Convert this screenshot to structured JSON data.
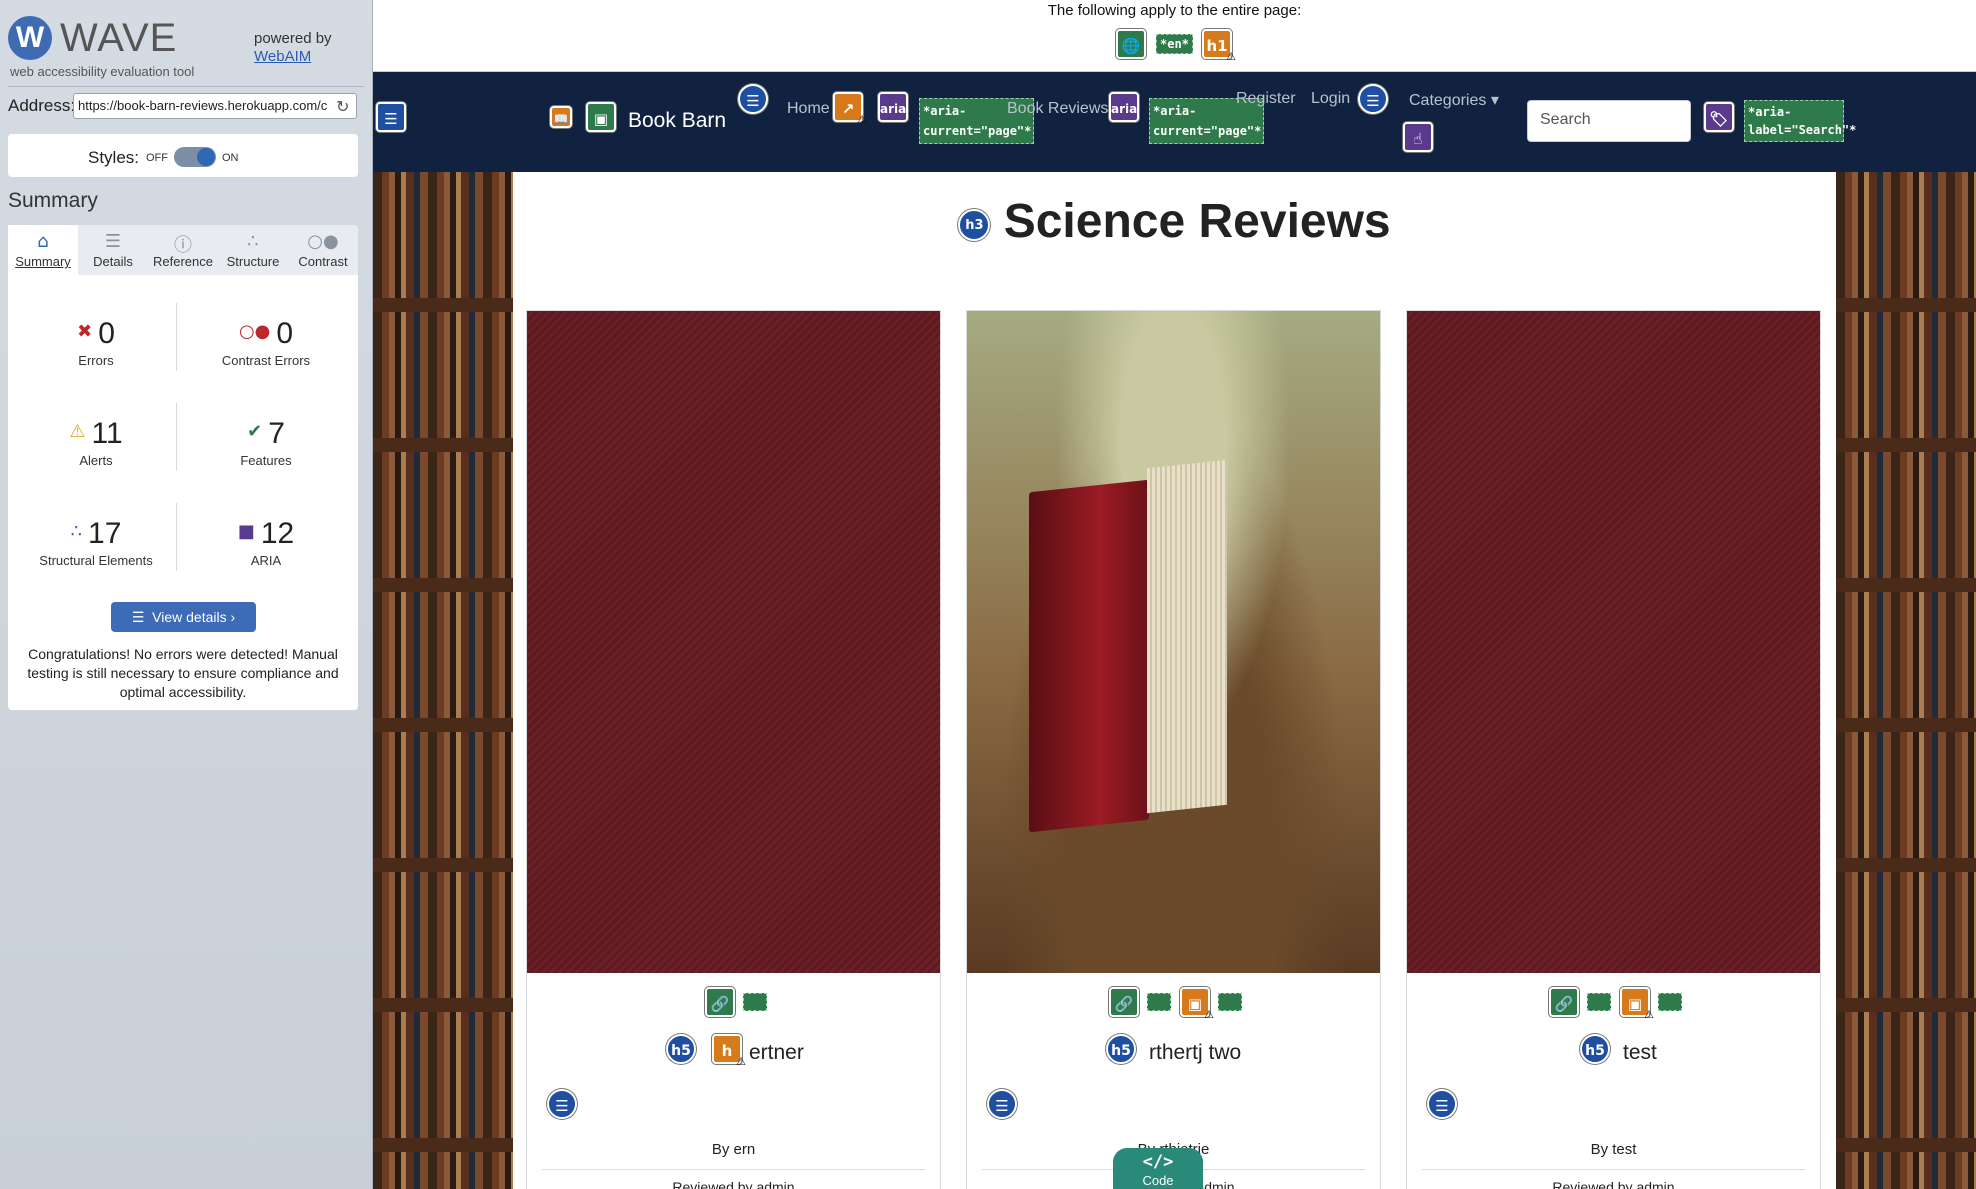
{
  "wave": {
    "title": "WAVE",
    "tagline": "web accessibility evaluation tool",
    "powered_by": "powered by",
    "webaim": "WebAIM",
    "address_label": "Address:",
    "address_value": "https://book-barn-reviews.herokuapp.com/c",
    "styles_label": "Styles:",
    "styles_off": "OFF",
    "styles_on": "ON",
    "summary_title": "Summary",
    "tabs": [
      {
        "label": "Summary",
        "icon": "home-icon"
      },
      {
        "label": "Details",
        "icon": "list-icon"
      },
      {
        "label": "Reference",
        "icon": "info-icon"
      },
      {
        "label": "Structure",
        "icon": "structure-icon"
      },
      {
        "label": "Contrast",
        "icon": "contrast-icon"
      }
    ],
    "stats": {
      "errors": {
        "count": "0",
        "label": "Errors",
        "color": "#c0272d"
      },
      "contrast_errors": {
        "count": "0",
        "label": "Contrast Errors",
        "color": "#c0272d"
      },
      "alerts": {
        "count": "11",
        "label": "Alerts",
        "color": "#e6a020"
      },
      "features": {
        "count": "7",
        "label": "Features",
        "color": "#2f7a4a"
      },
      "structural": {
        "count": "17",
        "label": "Structural Elements",
        "color": "#2f66b5"
      },
      "aria": {
        "count": "12",
        "label": "ARIA",
        "color": "#5a3a8c"
      }
    },
    "view_details": "View details ›",
    "congrats": "Congratulations! No errors were detected! Manual testing is still necessary to ensure compliance and optimal accessibility."
  },
  "page": {
    "apply_text": "The following apply to the entire page:",
    "lang_tag": "*en*",
    "h1_badge": "h1",
    "nav": {
      "brand": "Book Barn",
      "home": "Home",
      "book_reviews": "Book Reviews",
      "register": "Register",
      "login": "Login",
      "categories": "Categories",
      "search_placeholder": "Search",
      "aria_current": "*aria-current=\"page\"*",
      "aria_label_search": "*aria-label=\"Search\"*",
      "aria_badge": "aria"
    },
    "heading_badge": "h3",
    "heading": "Science Reviews",
    "cards": [
      {
        "title": "ertner",
        "by": "By ern",
        "reviewed": "Reviewed by admin",
        "h5": "h5"
      },
      {
        "title": "rthertj two",
        "by": "By rthietrje",
        "reviewed": "Reviewed by admin",
        "h5": "h5"
      },
      {
        "title": "test",
        "by": "By test",
        "reviewed": "Reviewed by admin",
        "h5": "h5"
      }
    ],
    "code_tab": {
      "icon": "</>",
      "label": "Code"
    }
  }
}
